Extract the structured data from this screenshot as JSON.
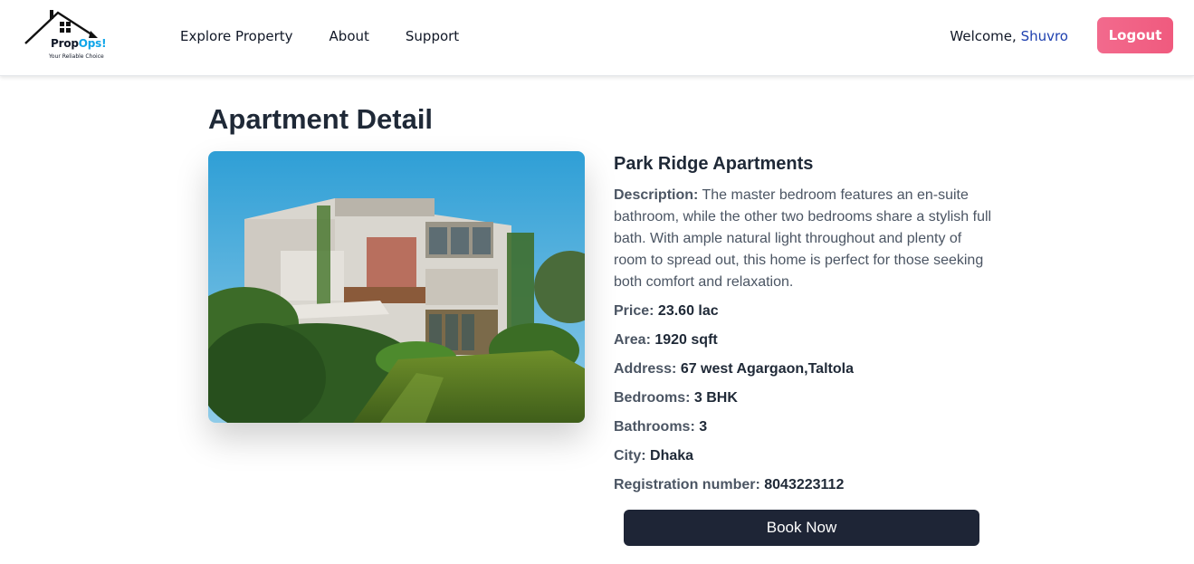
{
  "brand": {
    "name_part1": "Prop",
    "name_part2": "Ops!",
    "tagline": "Your Reliable Choice"
  },
  "nav": {
    "items": [
      {
        "label": "Explore Property"
      },
      {
        "label": "About"
      },
      {
        "label": "Support"
      }
    ]
  },
  "user": {
    "welcome_prefix": "Welcome, ",
    "name": "Shuvro",
    "logout_label": "Logout"
  },
  "page": {
    "title": "Apartment Detail"
  },
  "property": {
    "name": "Park Ridge Apartments",
    "description_label": "Description:",
    "description": "The master bedroom features an en-suite bathroom, while the other two bedrooms share a stylish full bath. With ample natural light throughout and plenty of room to spread out, this home is perfect for those seeking both comfort and relaxation.",
    "fields": [
      {
        "label": "Price:",
        "value": "23.60 lac"
      },
      {
        "label": "Area:",
        "value": "1920 sqft"
      },
      {
        "label": "Address:",
        "value": "67 west Agargaon,Taltola"
      },
      {
        "label": "Bedrooms:",
        "value": "3 BHK"
      },
      {
        "label": "Bathrooms:",
        "value": "3"
      },
      {
        "label": "City:",
        "value": "Dhaka"
      },
      {
        "label": "Registration number:",
        "value": "8043223112"
      }
    ],
    "book_label": "Book Now"
  },
  "colors": {
    "logout_bg": "#f26a8d",
    "book_bg": "#1e2536",
    "user_name": "#1e40af",
    "brand_accent": "#0ea5e9"
  }
}
